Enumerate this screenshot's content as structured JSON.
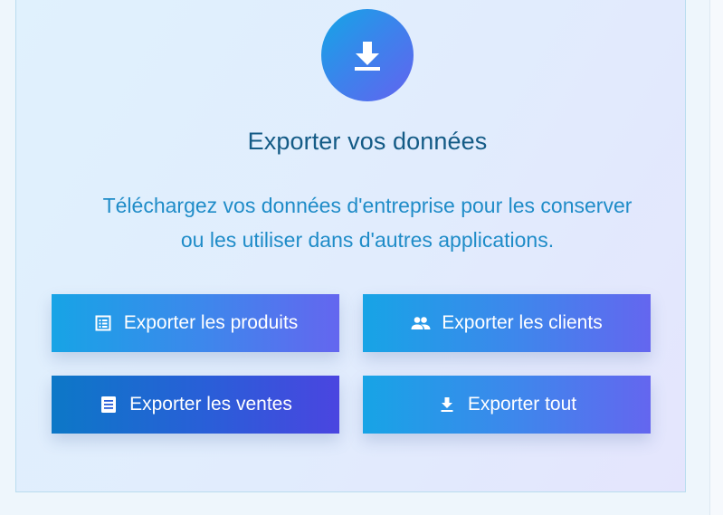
{
  "export_panel": {
    "icon": "download-icon",
    "title": "Exporter vos données",
    "description_line1": "Téléchargez vos données d'entreprise pour les conserver",
    "description_line2": "ou les utiliser dans d'autres applications."
  },
  "buttons": {
    "products": {
      "label": "Exporter les produits",
      "icon": "list-icon"
    },
    "clients": {
      "label": "Exporter les clients",
      "icon": "people-icon"
    },
    "sales": {
      "label": "Exporter les ventes",
      "icon": "document-icon"
    },
    "all": {
      "label": "Exporter tout",
      "icon": "download-icon"
    }
  },
  "colors": {
    "title": "#145b86",
    "description": "#1f8cc8",
    "button_gradient_start": "#17a4e6",
    "button_gradient_end": "#6466ef",
    "button_dark_start": "#0c78c7",
    "button_dark_end": "#4a45e0"
  }
}
